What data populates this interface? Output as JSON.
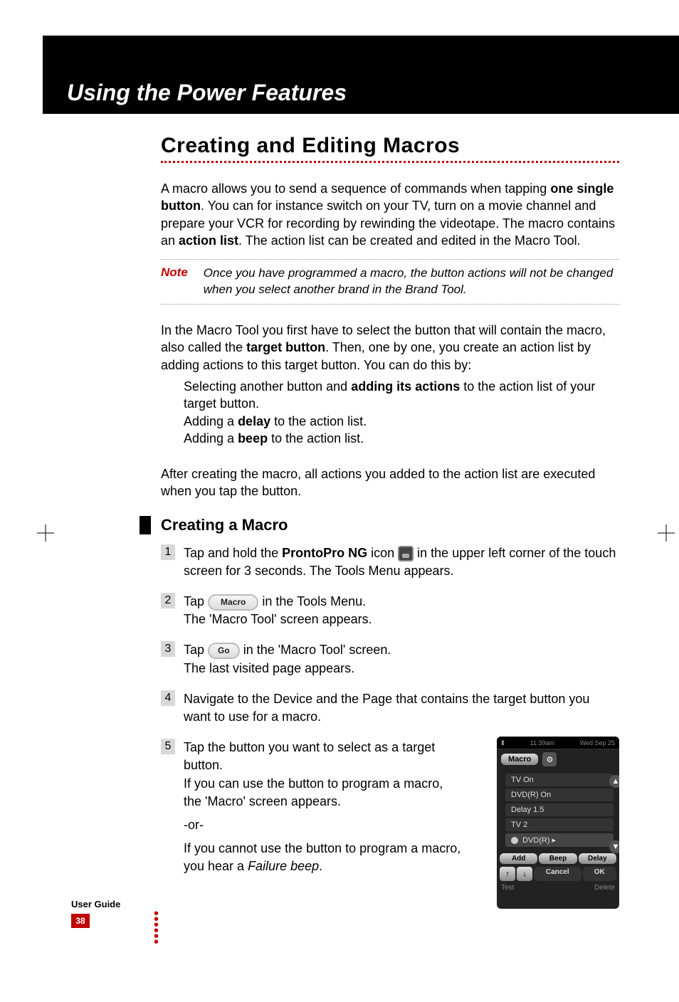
{
  "header": {
    "title": "Using the Power Features"
  },
  "section": {
    "title": "Creating and Editing Macros"
  },
  "intro": {
    "p1a": "A macro allows you to send a sequence of commands when tapping ",
    "p1b": "one single button",
    "p1c": ". You can for instance switch on your TV, turn on a movie channel and prepare your VCR for recording by rewinding the videotape. The macro contains an ",
    "p1d": "action list",
    "p1e": ". The action list can be created and edited in the Macro Tool."
  },
  "note": {
    "label": "Note",
    "text": "Once you have programmed a macro, the button actions will not be changed when you select another brand in the Brand Tool."
  },
  "p2": {
    "a": "In the Macro Tool you first have to select the button that will contain the macro, also called the ",
    "b": "target button",
    "c": ". Then, one by one, you create an action list by adding actions to this target button. You can do this by:"
  },
  "bullets": {
    "b1a": "Selecting another button and ",
    "b1b": "adding its actions",
    "b1c": " to the action list of your target button.",
    "b2a": "Adding a ",
    "b2b": "delay",
    "b2c": " to the action list.",
    "b3a": "Adding a ",
    "b3b": "beep",
    "b3c": " to the action list."
  },
  "p3": "After creating the macro, all actions you added to the action list are executed when you tap the button.",
  "subhead": "Creating a Macro",
  "steps": {
    "s1": {
      "num": "1",
      "a": "Tap and hold the ",
      "b": "ProntoPro NG",
      "c": " icon ",
      "d": " in the upper left corner of the touch screen for 3 seconds.",
      "sub": " The Tools Menu appears."
    },
    "s2": {
      "num": "2",
      "a": "Tap ",
      "pill": "Macro",
      "b": " in the Tools Menu.",
      "sub": "The 'Macro Tool' screen appears."
    },
    "s3": {
      "num": "3",
      "a": "Tap ",
      "pill": "Go",
      "b": " in the 'Macro Tool' screen.",
      "sub": "The last visited page appears."
    },
    "s4": {
      "num": "4",
      "a": "Navigate to the Device and the Page that contains the target button you want to use for a macro."
    },
    "s5": {
      "num": "5",
      "a": "Tap the button you want to select as a target button.",
      "sub1": "If you can use the button to program a macro, the 'Macro' screen appears.",
      "or": "-or-",
      "sub2a": "If you cannot use the button to program a macro, you hear a ",
      "sub2b": "Failure beep",
      "sub2c": "."
    }
  },
  "device": {
    "time": "11:39am",
    "date": "Wed Sep 25",
    "title": "Macro",
    "items": [
      "TV On",
      "DVD(R) On",
      "Delay 1.5",
      "TV 2",
      "DVD(R) ▸"
    ],
    "buttons": {
      "add": "Add",
      "beep": "Beep",
      "delay": "Delay",
      "cancel": "Cancel",
      "ok": "OK"
    },
    "bottom": {
      "test": "Test",
      "delete": "Delete"
    }
  },
  "footer": {
    "guide": "User Guide",
    "page": "38"
  }
}
